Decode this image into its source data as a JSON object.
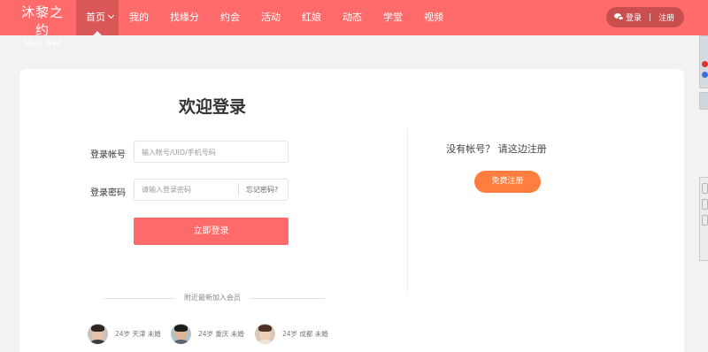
{
  "logo": {
    "main": "沐黎之约",
    "sub": "MoLi Wed"
  },
  "nav": {
    "items": [
      {
        "label": "首页"
      },
      {
        "label": "我的"
      },
      {
        "label": "找缘分"
      },
      {
        "label": "约会"
      },
      {
        "label": "活动"
      },
      {
        "label": "红娘"
      },
      {
        "label": "动态"
      },
      {
        "label": "学堂"
      },
      {
        "label": "视频"
      }
    ],
    "active_index": 0
  },
  "auth": {
    "login": "登录",
    "separator": "|",
    "register": "注册"
  },
  "login": {
    "title": "欢迎登录",
    "account_label": "登录帐号",
    "account_placeholder": "输入帐号/UID/手机号码",
    "password_label": "登录密码",
    "password_placeholder": "请输入登录密码",
    "forgot": "忘记密码?",
    "submit": "立即登录"
  },
  "recent": {
    "heading": "附近最新加入会员",
    "members": [
      {
        "info": "24岁 天津 未婚"
      },
      {
        "info": "24岁 重庆 未婚"
      },
      {
        "info": "24岁 成都 未婚"
      }
    ]
  },
  "register": {
    "prompt": "没有帐号？ 请这边注册",
    "button": "免费注册"
  },
  "colors": {
    "brand": "#ff6b6b",
    "nav_active": "#d95757",
    "register_button": "#ff7e3f",
    "page_bg": "#f2f2f2"
  },
  "icons": {
    "auth": "wechat-icon",
    "nav_caret": "chevron-down-icon"
  }
}
